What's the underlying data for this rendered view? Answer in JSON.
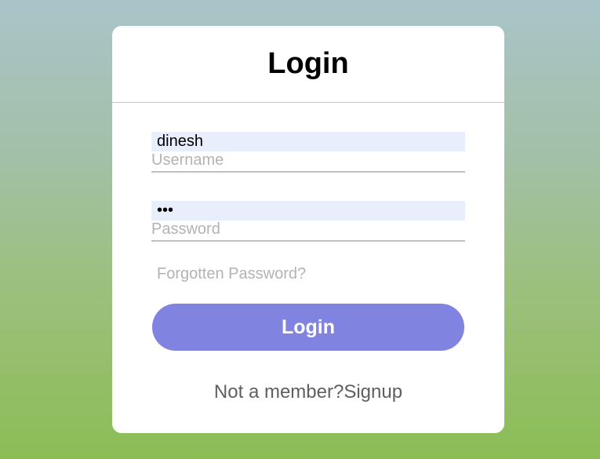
{
  "login_card": {
    "title": "Login",
    "username": {
      "value": "dinesh",
      "label": "Username"
    },
    "password": {
      "value": "•••",
      "label": "Password"
    },
    "forgot_password_label": "Forgotten Password?",
    "login_button_label": "Login",
    "signup_prompt": "Not a member?",
    "signup_link_label": "Signup"
  },
  "colors": {
    "button": "#8083e0",
    "input_fill": "#e8eefb",
    "label_gray": "#b3b3b3"
  }
}
